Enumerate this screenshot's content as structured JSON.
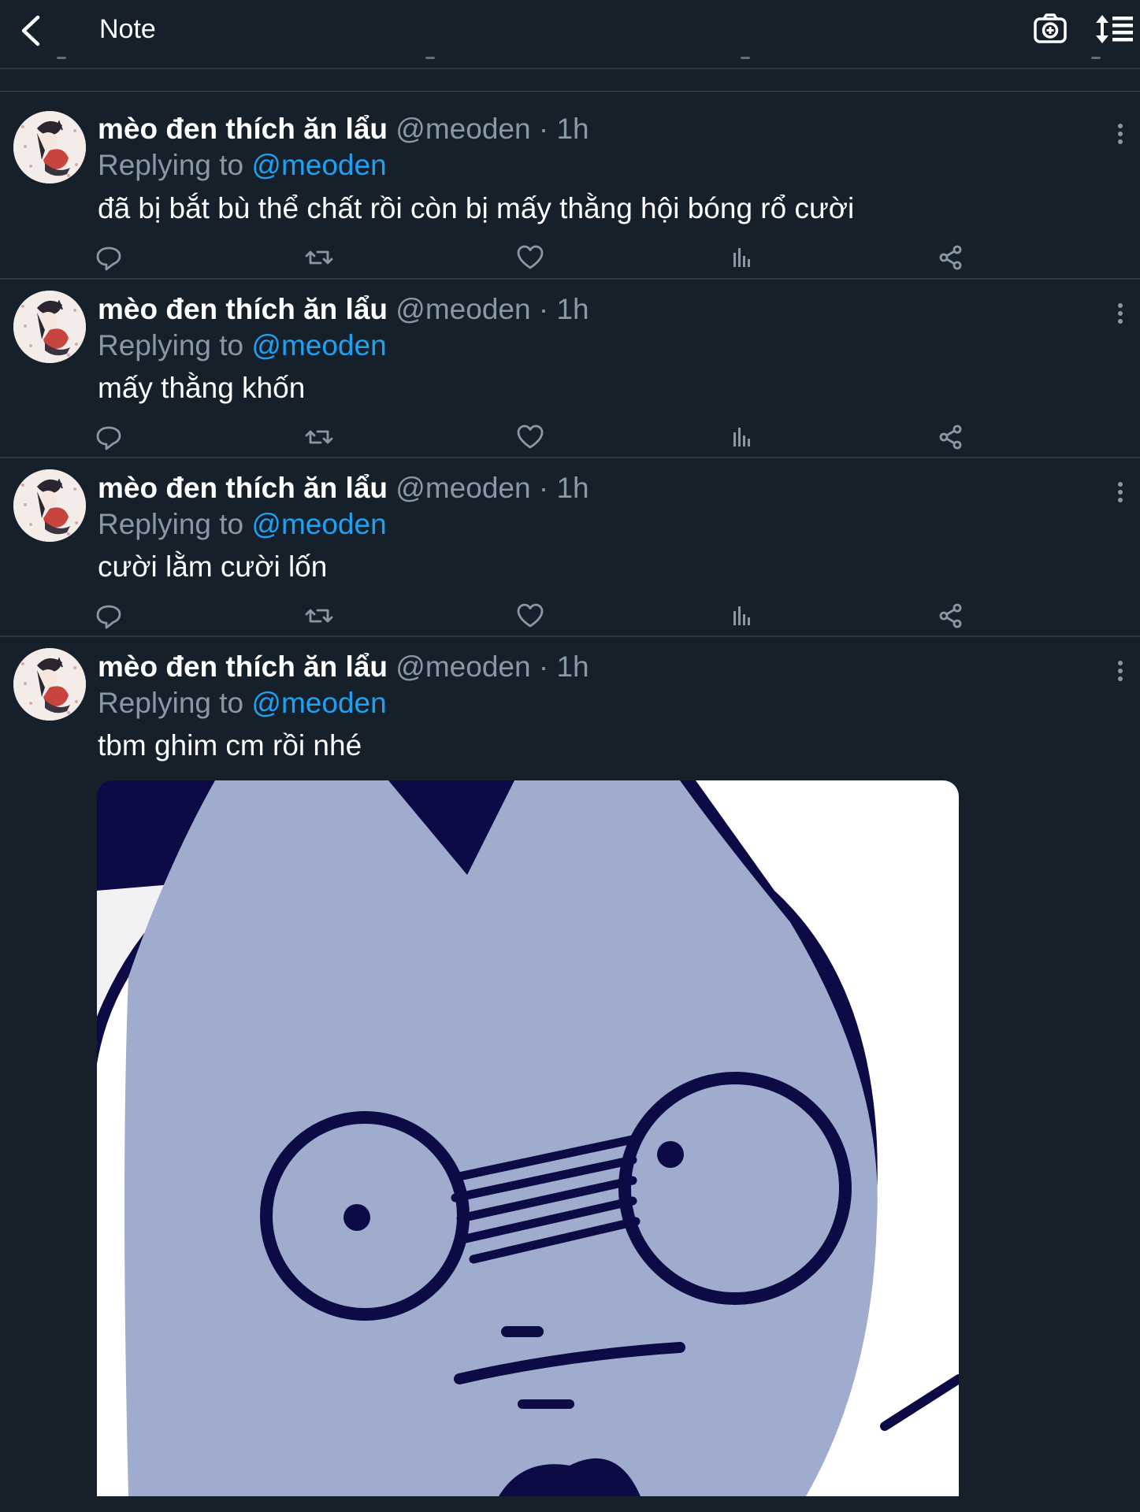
{
  "header": {
    "title": "Note",
    "back_icon": "chevron-left-icon",
    "camera_icon": "camera-plus-icon",
    "sort_icon": "sort-list-icon"
  },
  "colors": {
    "background": "#15202b",
    "divider": "#2a3744",
    "secondary_text": "#8899a6",
    "link": "#1da1f2",
    "icon": "#8899a6"
  },
  "tweets": [
    {
      "name": "mèo đen thích ăn lẩu",
      "handle": "@meoden",
      "separator": "·",
      "time": "1h",
      "replying_label": "Replying to",
      "reply_to": "@meoden",
      "text": "đã bị bắt bù thể chất rồi còn bị mấy thằng hội bóng rổ cười"
    },
    {
      "name": "mèo đen thích ăn lẩu",
      "handle": "@meoden",
      "separator": "·",
      "time": "1h",
      "replying_label": "Replying to",
      "reply_to": "@meoden",
      "text": "mấy thằng khốn"
    },
    {
      "name": "mèo đen thích ăn lẩu",
      "handle": "@meoden",
      "separator": "·",
      "time": "1h",
      "replying_label": "Replying to",
      "reply_to": "@meoden",
      "text": "cười lằm cười lốn"
    },
    {
      "name": "mèo đen thích ăn lẩu",
      "handle": "@meoden",
      "separator": "·",
      "time": "1h",
      "replying_label": "Replying to",
      "reply_to": "@meoden",
      "text": "tbm ghim cm rồi nhé",
      "has_media": true
    }
  ],
  "actions": [
    "reply-icon",
    "retweet-icon",
    "like-icon",
    "analytics-icon",
    "share-icon"
  ]
}
